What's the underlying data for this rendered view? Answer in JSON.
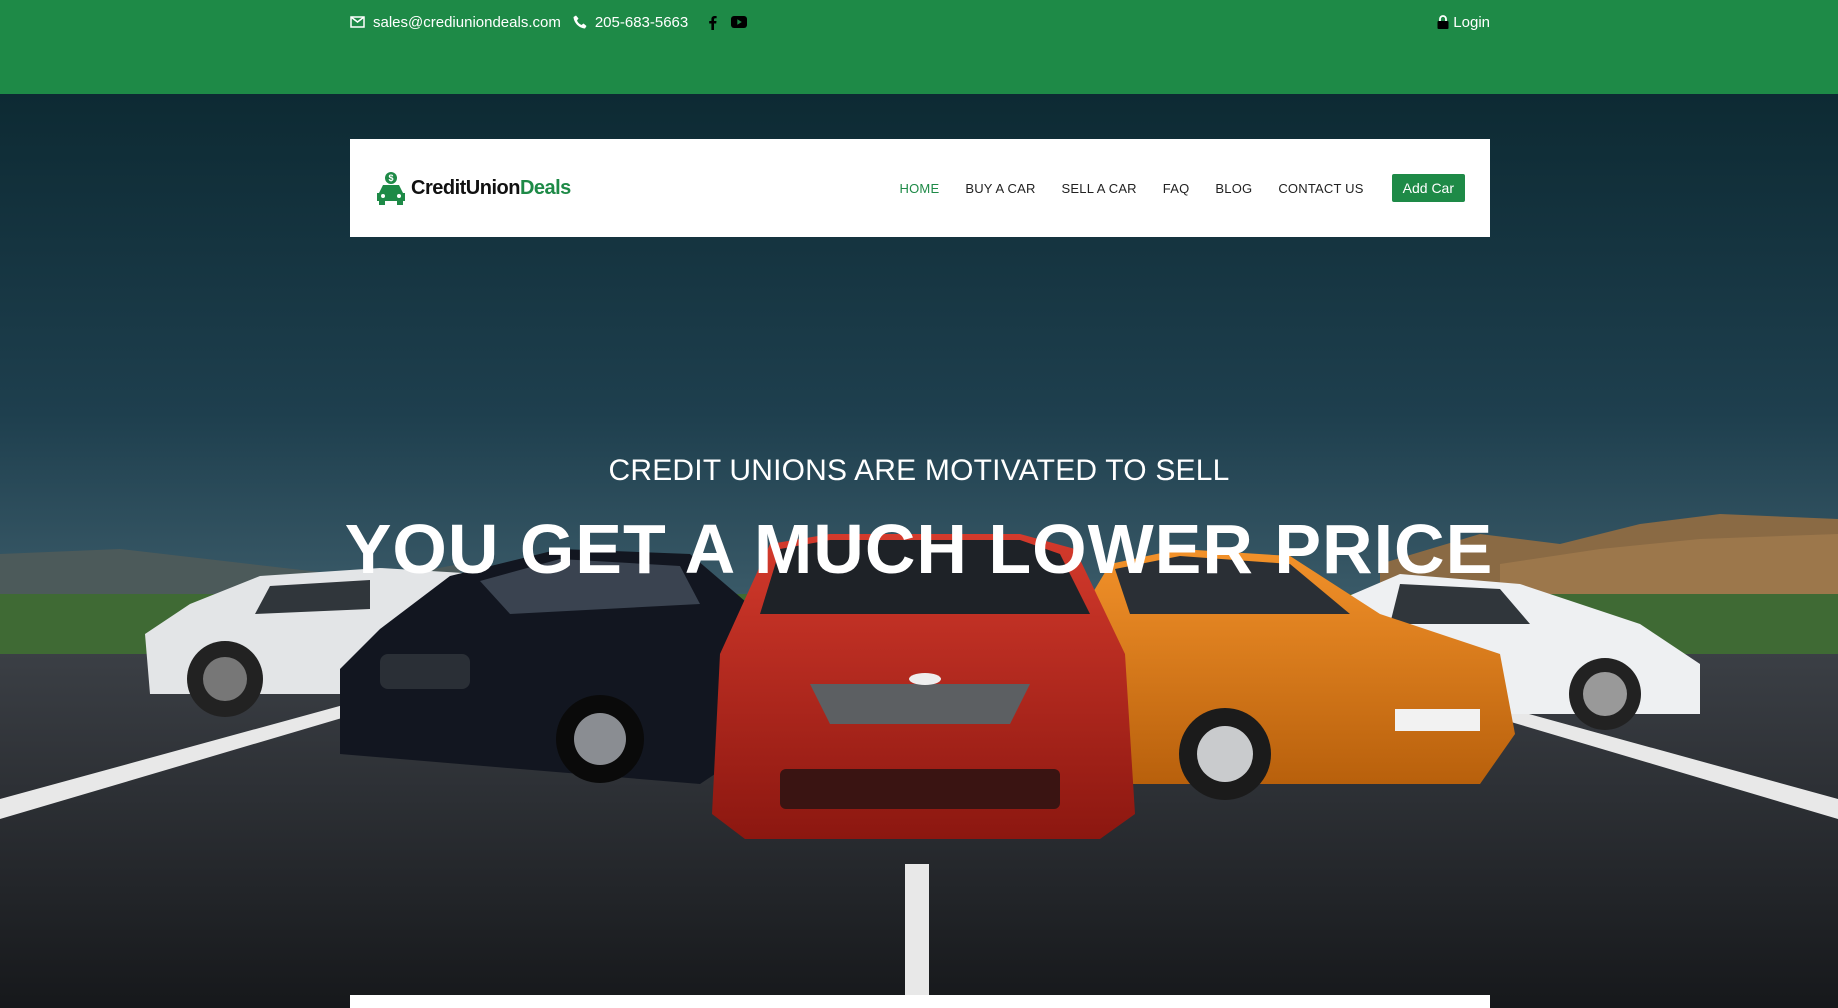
{
  "topbar": {
    "email": "sales@crediuniondeals.com",
    "phone": "205-683-5663",
    "login": "Login"
  },
  "logo": {
    "part1": "CreditUnion",
    "part2": "Deals"
  },
  "nav": {
    "items": [
      {
        "label": "HOME",
        "active": true
      },
      {
        "label": "BUY A CAR"
      },
      {
        "label": "SELL A CAR"
      },
      {
        "label": "FAQ"
      },
      {
        "label": "BLOG"
      },
      {
        "label": "CONTACT US"
      }
    ],
    "add_car": "Add Car"
  },
  "hero": {
    "subtitle": "CREDIT UNIONS ARE MOTIVATED TO SELL",
    "title": "YOU GET A MUCH LOWER PRICE"
  },
  "colors": {
    "brand_green": "#1e8a47"
  }
}
